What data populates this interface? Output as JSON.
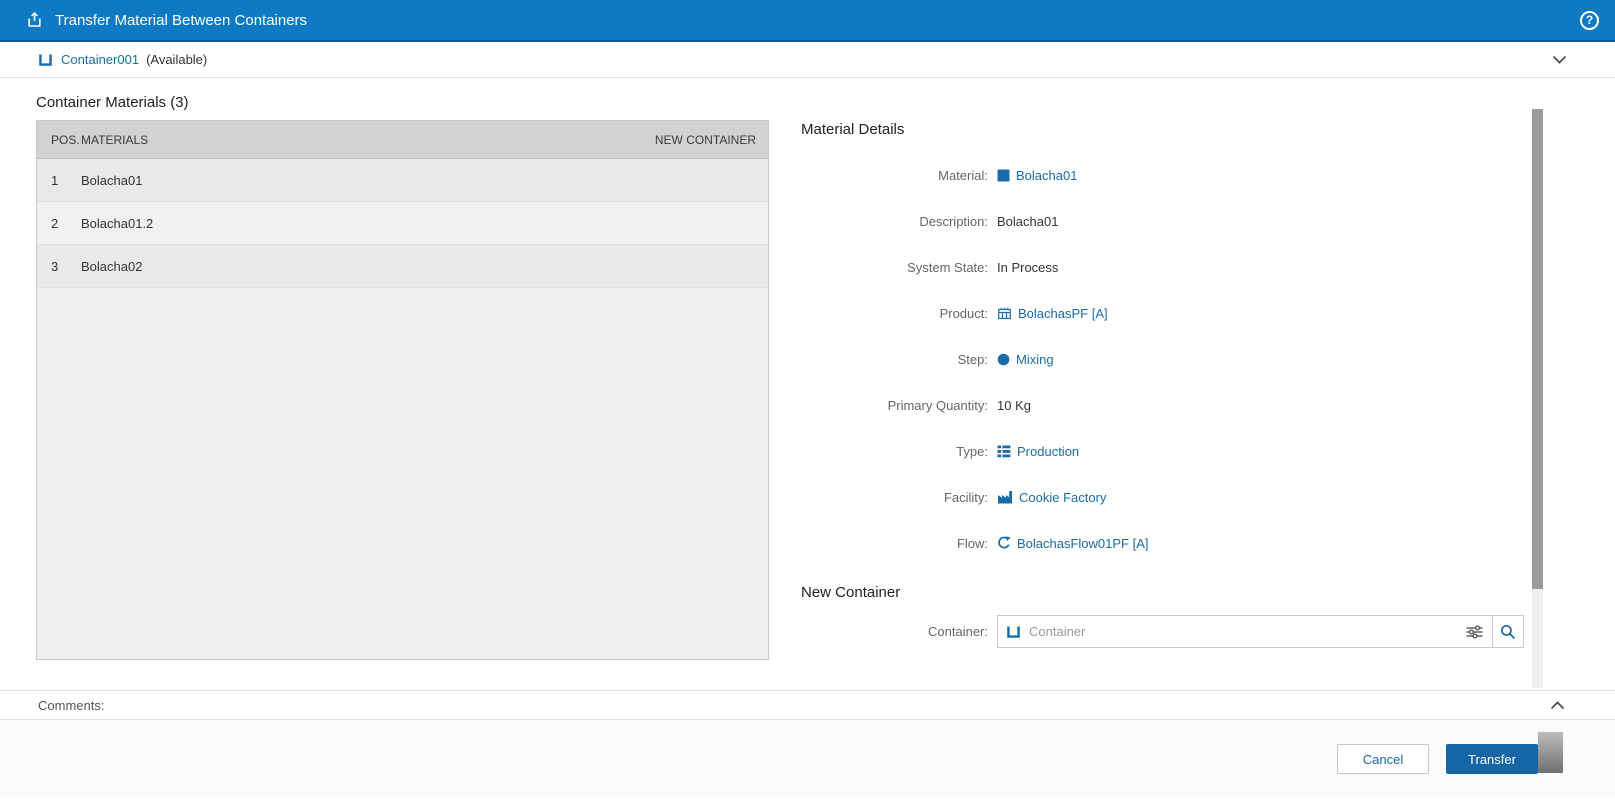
{
  "colors": {
    "header_blue": "#0e7ac4",
    "link_blue": "#1a6ba8",
    "transfer_button_blue": "#1566a6",
    "table_header_gray": "#d2d2d2"
  },
  "header": {
    "title": "Transfer Material Between Containers",
    "help_glyph": "?"
  },
  "container_bar": {
    "name": "Container001",
    "state": "(Available)"
  },
  "materials_panel": {
    "title": "Container Materials (3)",
    "columns": {
      "pos": "POS.",
      "materials": "MATERIALS",
      "new_container": "NEW CONTAINER"
    },
    "rows": [
      {
        "pos": "1",
        "material": "Bolacha01",
        "new_container": ""
      },
      {
        "pos": "2",
        "material": "Bolacha01.2",
        "new_container": ""
      },
      {
        "pos": "3",
        "material": "Bolacha02",
        "new_container": ""
      }
    ]
  },
  "details_panel": {
    "title": "Material Details",
    "fields": [
      {
        "label": "Material:",
        "value": "Bolacha01",
        "type": "link",
        "icon": "material-icon"
      },
      {
        "label": "Description:",
        "value": "Bolacha01",
        "type": "text",
        "icon": ""
      },
      {
        "label": "System State:",
        "value": "In Process",
        "type": "text",
        "icon": ""
      },
      {
        "label": "Product:",
        "value": "BolachasPF [A]",
        "type": "link",
        "icon": "product-icon"
      },
      {
        "label": "Step:",
        "value": "Mixing",
        "type": "link",
        "icon": "step-icon"
      },
      {
        "label": "Primary Quantity:",
        "value": "10 Kg",
        "type": "text",
        "icon": ""
      },
      {
        "label": "Type:",
        "value": "Production",
        "type": "link",
        "icon": "type-icon"
      },
      {
        "label": "Facility:",
        "value": "Cookie Factory",
        "type": "link",
        "icon": "facility-icon"
      },
      {
        "label": "Flow:",
        "value": "BolachasFlow01PF [A]",
        "type": "link",
        "icon": "flow-icon"
      }
    ]
  },
  "new_container": {
    "title": "New Container",
    "label": "Container:",
    "placeholder": "Container"
  },
  "comments": {
    "label": "Comments:"
  },
  "footer": {
    "cancel_label": "Cancel",
    "transfer_label": "Transfer"
  }
}
